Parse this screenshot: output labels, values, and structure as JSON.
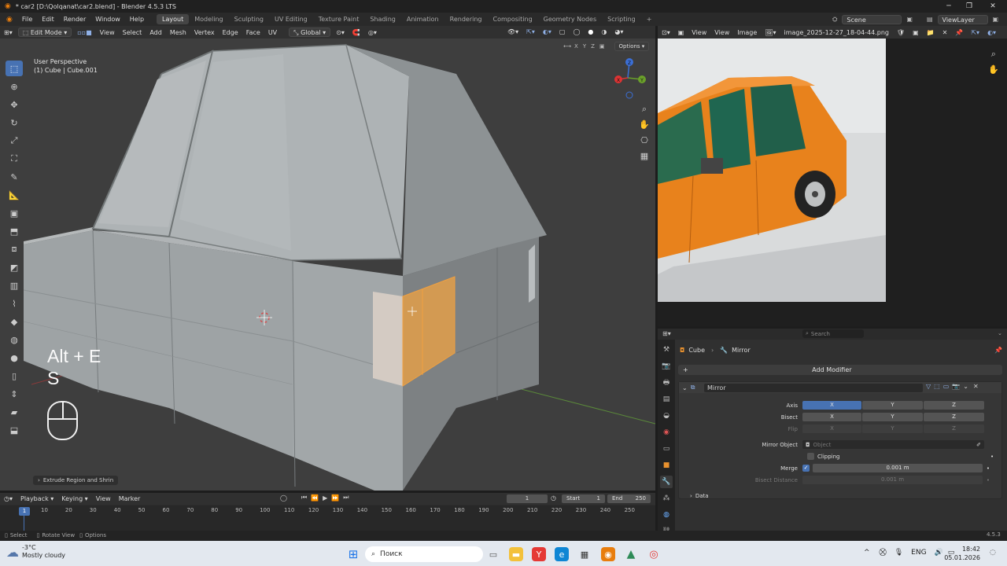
{
  "window": {
    "title": "* car2 [D:\\Qolqanat\\car2.blend] - Blender 4.5.3 LTS",
    "controls": [
      "─",
      "❐",
      "✕"
    ]
  },
  "menubar": {
    "menus": [
      "File",
      "Edit",
      "Render",
      "Window",
      "Help"
    ],
    "workspaces": [
      "Layout",
      "Modeling",
      "Sculpting",
      "UV Editing",
      "Texture Paint",
      "Shading",
      "Animation",
      "Rendering",
      "Compositing",
      "Geometry Nodes",
      "Scripting"
    ],
    "add_workspace": "+",
    "scene_label": "Scene",
    "viewlayer_label": "ViewLayer"
  },
  "viewport_header": {
    "mode": "Edit Mode",
    "menus": [
      "View",
      "Select",
      "Add",
      "Mesh",
      "Vertex",
      "Edge",
      "Face",
      "UV"
    ],
    "orientation": "Global"
  },
  "viewport": {
    "perspective": "User Perspective",
    "object_info": "(1) Cube | Cube.001",
    "options_label": "Options",
    "axes": [
      "X",
      "Y",
      "Z"
    ],
    "gizmo": {
      "x": "X",
      "y": "Y",
      "z": "Z"
    },
    "overlay_key1": "Alt + E",
    "overlay_key2": "S",
    "last_op": "Extrude Region and Shrin"
  },
  "image_editor": {
    "menus": [
      "View",
      "View",
      "Image"
    ],
    "image_name": "image_2025-12-27_18-04-44.png"
  },
  "properties": {
    "search_placeholder": "Search",
    "breadcrumb_object": "Cube",
    "breadcrumb_modifier": "Mirror",
    "add_modifier": "Add Modifier",
    "modifier_name": "Mirror",
    "axis_label": "Axis",
    "bisect_label": "Bisect",
    "flip_label": "Flip",
    "xyz": [
      "X",
      "Y",
      "Z"
    ],
    "mirror_object_label": "Mirror Object",
    "mirror_object_placeholder": "Object",
    "clipping_label": "Clipping",
    "merge_label": "Merge",
    "merge_value": "0.001 m",
    "bisect_distance_label": "Bisect Distance",
    "bisect_distance_value": "0.001 m",
    "data_label": "Data"
  },
  "timeline": {
    "menus": [
      "Playback",
      "Keying",
      "View",
      "Marker"
    ],
    "current_frame": "1",
    "start_label": "Start",
    "start_value": "1",
    "end_label": "End",
    "end_value": "250",
    "ticks": [
      "10",
      "20",
      "30",
      "40",
      "50",
      "60",
      "70",
      "80",
      "90",
      "100",
      "110",
      "120",
      "130",
      "140",
      "150",
      "160",
      "170",
      "180",
      "190",
      "200",
      "210",
      "220",
      "230",
      "240",
      "250"
    ],
    "playhead": "1"
  },
  "statusbar": {
    "select": "Select",
    "rotate": "Rotate View",
    "options": "Options",
    "version": "4.5.3"
  },
  "taskbar": {
    "weather_temp": "-3°C",
    "weather_desc": "Mostly cloudy",
    "search_placeholder": "Поиск",
    "language": "ENG",
    "time": "18:42",
    "date": "05.01.2026",
    "tray_arrow": "^"
  },
  "colors": {
    "accent": "#4772b3",
    "selection": "#e8912e",
    "car_orange": "#e8821c"
  }
}
